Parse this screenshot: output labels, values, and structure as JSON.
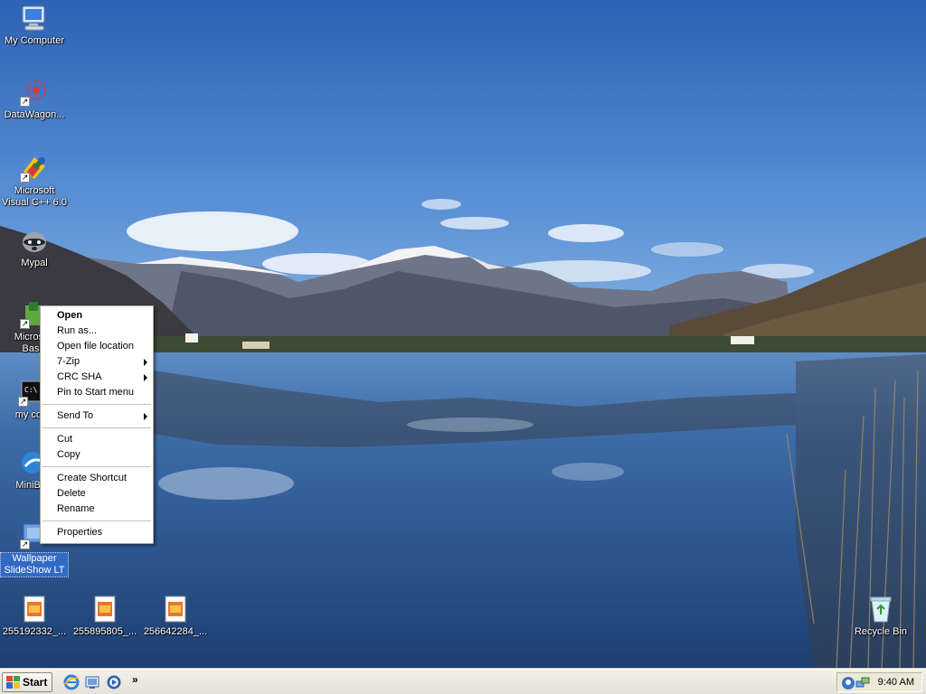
{
  "desktop": {
    "icons": [
      {
        "label": "My Computer",
        "icon": "my-computer-icon"
      },
      {
        "label": "DataWagon...",
        "icon": "datawagon-icon"
      },
      {
        "label": "Microsoft Visual C++ 6.0",
        "icon": "visual-cpp-icon"
      },
      {
        "label": "Mypal",
        "icon": "mypal-raccoon-icon"
      },
      {
        "label": "Microsoft Basic",
        "icon": "microsoft-basic-icon"
      },
      {
        "label": "my com",
        "icon": "command-prompt-icon"
      },
      {
        "label": "MiniBro",
        "icon": "minibrowser-icon"
      },
      {
        "label": "Wallpaper SlideShow LT",
        "icon": "wallpaper-slideshow-icon"
      },
      {
        "label": "255192332_...",
        "icon": "image-file-icon"
      },
      {
        "label": "255895805_...",
        "icon": "image-file-icon"
      },
      {
        "label": "256642284_...",
        "icon": "image-file-icon"
      },
      {
        "label": "Recycle Bin",
        "icon": "recycle-bin-icon"
      }
    ]
  },
  "context_menu": {
    "items": [
      {
        "label": "Open",
        "bold": true
      },
      {
        "label": "Run as..."
      },
      {
        "label": "Open file location"
      },
      {
        "label": "7-Zip",
        "submenu": true
      },
      {
        "label": "CRC SHA",
        "submenu": true
      },
      {
        "label": "Pin to Start menu"
      },
      {
        "label": "Send To",
        "submenu": true
      },
      {
        "label": "Cut"
      },
      {
        "label": "Copy"
      },
      {
        "label": "Create Shortcut"
      },
      {
        "label": "Delete"
      },
      {
        "label": "Rename"
      },
      {
        "label": "Properties"
      }
    ]
  },
  "taskbar": {
    "start_label": "Start",
    "quick_launch": [
      "internet-explorer-icon",
      "show-desktop-icon",
      "media-player-icon"
    ],
    "chevron": "»",
    "tray_icons": [
      "messenger-icon",
      "network-icon"
    ],
    "clock": "9:40 AM"
  },
  "colors": {
    "selection": "#316ac5",
    "taskbar": "#ece9d8",
    "sky": "#3f74c4",
    "lake": "#2c5a95"
  }
}
